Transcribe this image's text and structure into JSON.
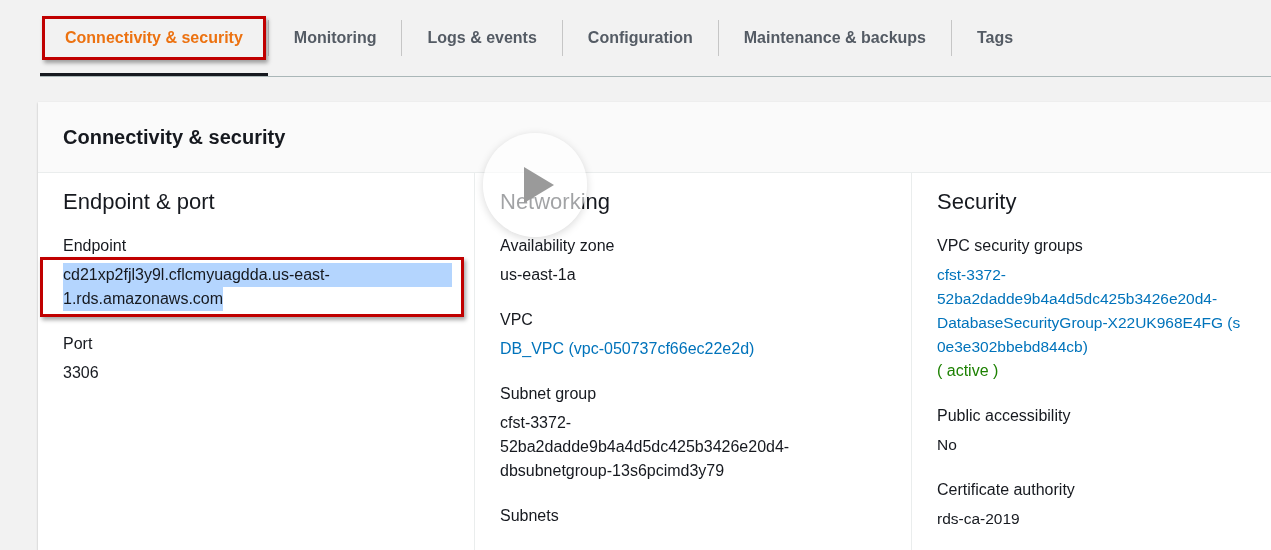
{
  "tabs": [
    {
      "label": "Connectivity & security",
      "selected": true,
      "annotated": true
    },
    {
      "label": "Monitoring",
      "selected": false,
      "annotated": false
    },
    {
      "label": "Logs & events",
      "selected": false,
      "annotated": false
    },
    {
      "label": "Configuration",
      "selected": false,
      "annotated": false
    },
    {
      "label": "Maintenance & backups",
      "selected": false,
      "annotated": false
    },
    {
      "label": "Tags",
      "selected": false,
      "annotated": false
    }
  ],
  "panel": {
    "title": "Connectivity & security",
    "columns": [
      {
        "heading": "Endpoint & port",
        "fields": [
          {
            "label": "Endpoint",
            "kind": "text",
            "lines": [
              "cd21xp2fjl3y9l.cflcmyuagdda.us-east-",
              "1.rds.amazonaws.com"
            ],
            "text_selected": true,
            "annotated": true
          },
          {
            "label": "Port",
            "kind": "text",
            "lines": [
              "3306"
            ]
          }
        ]
      },
      {
        "heading": "Networking",
        "fields": [
          {
            "label": "Availability zone",
            "kind": "text",
            "lines": [
              "us-east-1a"
            ]
          },
          {
            "label": "VPC",
            "kind": "link",
            "lines": [
              "DB_VPC (vpc-050737cf66ec22e2d)"
            ]
          },
          {
            "label": "Subnet group",
            "kind": "text",
            "lines": [
              "cfst-3372-",
              "52ba2dadde9b4a4d5dc425b3426e20d4-",
              "dbsubnetgroup-13s6pcimd3y79"
            ]
          },
          {
            "label": "Subnets"
          }
        ]
      },
      {
        "heading": "Security",
        "fields": [
          {
            "label": "VPC security groups",
            "kind": "link",
            "lines": [
              "cfst-3372-",
              "52ba2dadde9b4a4d5dc425b3426e20d4-",
              "DatabaseSecurityGroup-X22UK968E4FG (s",
              "0e3e302bbebd844cb)"
            ],
            "status": "( active )"
          },
          {
            "label": "Public accessibility",
            "kind": "text",
            "lines": [
              "No"
            ]
          },
          {
            "label": "Certificate authority",
            "kind": "text",
            "lines": [
              "rds-ca-2019"
            ]
          }
        ]
      }
    ]
  }
}
